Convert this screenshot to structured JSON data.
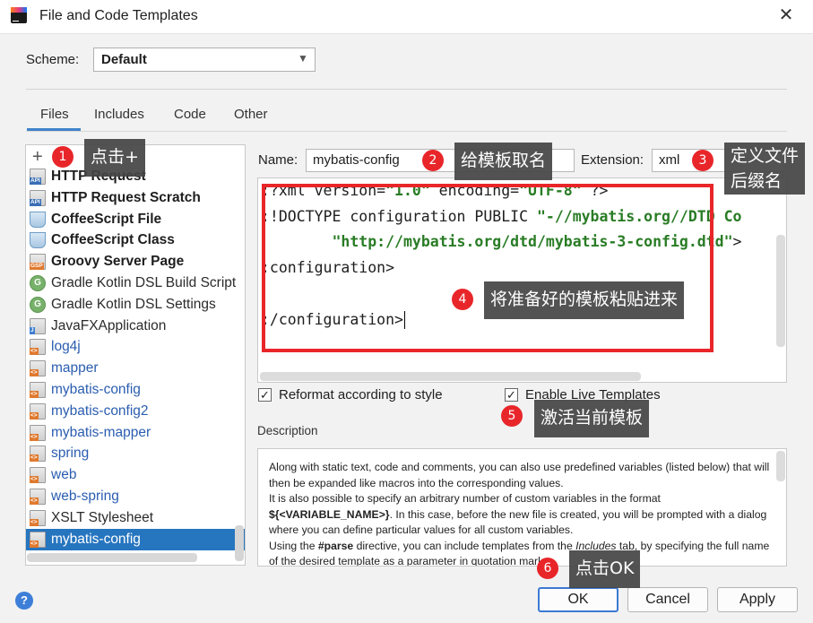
{
  "window": {
    "title": "File and Code Templates",
    "close_glyph": "✕"
  },
  "scheme": {
    "label": "Scheme:",
    "value": "Default"
  },
  "tabs": [
    {
      "label": "Files",
      "active": true
    },
    {
      "label": "Includes"
    },
    {
      "label": "Code"
    },
    {
      "label": "Other"
    }
  ],
  "left_panel": {
    "add_glyph": "+",
    "items": [
      {
        "label": "HTTP Request",
        "style": "bold",
        "icon": "api-file-icon",
        "tag": "API"
      },
      {
        "label": "HTTP Request Scratch",
        "style": "bold",
        "icon": "api-file-icon",
        "tag": "API"
      },
      {
        "label": "CoffeeScript File",
        "style": "bold",
        "icon": "coffee-cup-icon"
      },
      {
        "label": "CoffeeScript Class",
        "style": "bold",
        "icon": "coffee-cup-icon"
      },
      {
        "label": "Groovy Server Page",
        "style": "bold",
        "icon": "gsp-file-icon",
        "tag": "GSP"
      },
      {
        "label": "Gradle Kotlin DSL Build Script",
        "style": "black",
        "icon": "gradle-icon",
        "tag": "G"
      },
      {
        "label": "Gradle Kotlin DSL Settings",
        "style": "black",
        "icon": "gradle-icon",
        "tag": "G"
      },
      {
        "label": "JavaFXApplication",
        "style": "black",
        "icon": "java-file-icon",
        "tag": "J"
      },
      {
        "label": "log4j",
        "style": "blue",
        "icon": "xml-file-icon",
        "tag": "<>"
      },
      {
        "label": "mapper",
        "style": "blue",
        "icon": "xml-file-icon",
        "tag": "<>"
      },
      {
        "label": "mybatis-config",
        "style": "blue",
        "icon": "xml-file-icon",
        "tag": "<>"
      },
      {
        "label": "mybatis-config2",
        "style": "blue",
        "icon": "xml-file-icon",
        "tag": "<>"
      },
      {
        "label": "mybatis-mapper",
        "style": "blue",
        "icon": "xml-file-icon",
        "tag": "<>"
      },
      {
        "label": "spring",
        "style": "blue",
        "icon": "xml-file-icon",
        "tag": "<>"
      },
      {
        "label": "web",
        "style": "blue",
        "icon": "xml-file-icon",
        "tag": "<>"
      },
      {
        "label": "web-spring",
        "style": "blue",
        "icon": "xml-file-icon",
        "tag": "<>"
      },
      {
        "label": "XSLT Stylesheet",
        "style": "black",
        "icon": "xml-file-icon",
        "tag": "<>"
      },
      {
        "label": "mybatis-config",
        "style": "selected",
        "icon": "xml-file-icon",
        "tag": "<>"
      }
    ]
  },
  "template_form": {
    "name_label": "Name:",
    "name_value": "mybatis-config",
    "extension_label": "Extension:",
    "extension_value": "xml"
  },
  "editor": {
    "lines": [
      [
        {
          "t": ":?xml version=",
          "c": "kw"
        },
        {
          "t": "\"1.0\"",
          "c": "str"
        },
        {
          "t": " encoding=",
          "c": "kw"
        },
        {
          "t": "\"UTF-8\"",
          "c": "str"
        },
        {
          "t": " ?>",
          "c": "kw"
        }
      ],
      [
        {
          "t": ":!DOCTYPE configuration PUBLIC ",
          "c": "kw"
        },
        {
          "t": "\"-//mybatis.org//DTD Co",
          "c": "str"
        }
      ],
      [
        {
          "t": "        ",
          "c": "kw"
        },
        {
          "t": "\"http://mybatis.org/dtd/mybatis-3-config.dtd\"",
          "c": "str"
        },
        {
          "t": ">",
          "c": "kw"
        }
      ],
      [
        {
          "t": ":configuration>",
          "c": "kw"
        }
      ],
      [
        {
          "t": "",
          "c": "kw"
        }
      ],
      [
        {
          "t": ":/configuration>",
          "c": "kw"
        }
      ]
    ]
  },
  "options": {
    "reformat_label": "Reformat according to style",
    "reformat_checked": true,
    "live_templates_label": "Enable Live Templates",
    "live_templates_checked": true
  },
  "description": {
    "label": "Description",
    "p1": "Along with static text, code and comments, you can also use predefined variables (listed below) that will then be expanded like macros into the corresponding values.",
    "p2": "It is also possible to specify an arbitrary number of custom variables in the format ",
    "p2_var": "${<VARIABLE_NAME>}",
    "p2_rest": ". In this case, before the new file is created, you will be prompted with a dialog where you can define particular values for all custom variables.",
    "p3_a": "Using the ",
    "p3_parse": "#parse",
    "p3_b": " directive, you can include templates from the ",
    "p3_includes": "Includes",
    "p3_c": " tab, by specifying the full name of the desired template as a parameter in quotation marks."
  },
  "footer": {
    "help_glyph": "?",
    "ok_label": "OK",
    "cancel_label": "Cancel",
    "apply_label": "Apply"
  },
  "annotations": [
    {
      "num": "1",
      "text": "点击+"
    },
    {
      "num": "2",
      "text": "给模板取名"
    },
    {
      "num": "3",
      "text": "定义文件",
      "text2": "后缀名"
    },
    {
      "num": "4",
      "text": "将准备好的模板粘贴进来"
    },
    {
      "num": "5",
      "text": "激活当前模板"
    },
    {
      "num": "6",
      "text": "点击OK"
    }
  ],
  "colors": {
    "accent": "#2675bf",
    "annotation_red": "#e8262a",
    "callout_bg": "#444444",
    "string_green": "#297c25",
    "link_blue": "#2a5db0"
  }
}
